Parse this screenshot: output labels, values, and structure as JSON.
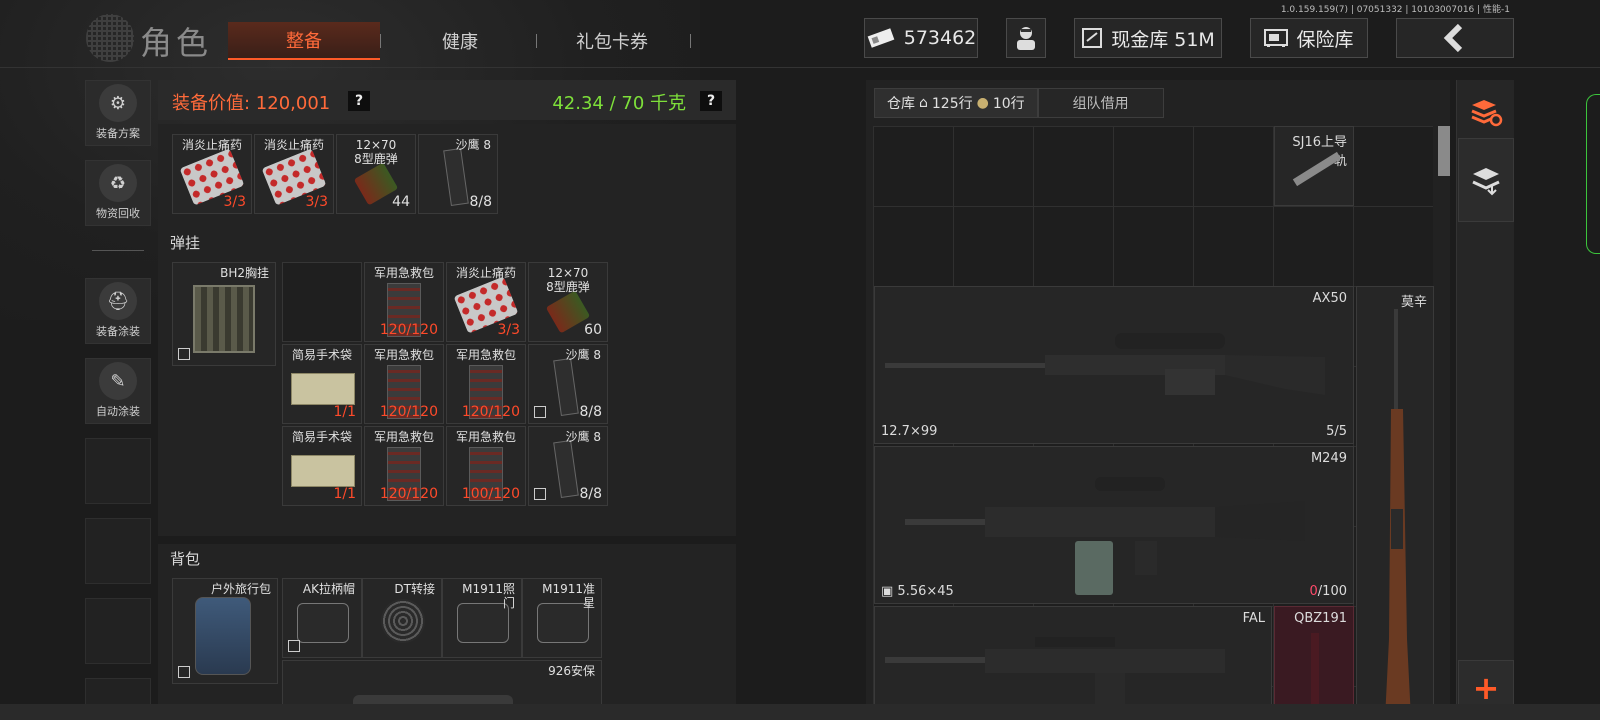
{
  "build_info": "1.0.159.159(7) | 07051332 | 10103007016 | 性能-1",
  "header": {
    "title": "角色",
    "tabs": [
      {
        "label": "整备",
        "active": true
      },
      {
        "label": "健康",
        "active": false
      },
      {
        "label": "礼包卡券",
        "active": false
      }
    ],
    "currency": "573462",
    "cash_vault": "现金库 51M",
    "safe_box": "保险库"
  },
  "sidebar": {
    "buttons": [
      {
        "label": "装备方案",
        "icon": "loadout-icon"
      },
      {
        "label": "物资回收",
        "icon": "recycle-icon"
      },
      {
        "label": "装备涂装",
        "icon": "helmet-paint-icon"
      },
      {
        "label": "自动涂装",
        "icon": "auto-paint-icon"
      }
    ]
  },
  "loadout": {
    "value_label": "装备价值: 120,001",
    "weight_label": "42.34 / 70 千克",
    "help": "?",
    "pockets": [
      {
        "name": "消炎止痛药",
        "qty": "3/3",
        "qty_color": "red",
        "art": "pills"
      },
      {
        "name": "消炎止痛药",
        "qty": "3/3",
        "qty_color": "red",
        "art": "pills"
      },
      {
        "name": "12×70\n8型鹿弹",
        "qty": "44",
        "qty_color": "white",
        "art": "shell"
      },
      {
        "name": "沙鹰 8",
        "qty": "8/8",
        "qty_color": "white",
        "art": "mag"
      }
    ],
    "rig_label": "弹挂",
    "rig": {
      "name": "BH2胸挂"
    },
    "rig_slots": [
      [
        null,
        {
          "name": "军用急救包",
          "qty": "120/120",
          "art": "medkit"
        },
        {
          "name": "消炎止痛药",
          "qty": "3/3",
          "art": "pills"
        },
        {
          "name": "12×70\n8型鹿弹",
          "qty": "60",
          "qty_color": "white",
          "art": "shell"
        }
      ],
      [
        {
          "name": "简易手术袋",
          "qty": "1/1",
          "art": "pouch"
        },
        {
          "name": "军用急救包",
          "qty": "120/120",
          "art": "medkit"
        },
        {
          "name": "军用急救包",
          "qty": "120/120",
          "art": "medkit"
        },
        {
          "name": "沙鹰 8",
          "qty": "8/8",
          "qty_color": "white",
          "art": "mag"
        }
      ],
      [
        {
          "name": "简易手术袋",
          "qty": "1/1",
          "art": "pouch"
        },
        {
          "name": "军用急救包",
          "qty": "120/120",
          "art": "medkit"
        },
        {
          "name": "军用急救包",
          "qty": "100/120",
          "art": "medkit"
        },
        {
          "name": "沙鹰 8",
          "qty": "8/8",
          "qty_color": "white",
          "art": "mag"
        }
      ]
    ],
    "backpack_label": "背包",
    "backpack": {
      "name": "户外旅行包"
    },
    "backpack_slots": [
      {
        "name": "AK拉柄帽",
        "art": "gearpart"
      },
      {
        "name": "DT转接",
        "art": "coil"
      },
      {
        "name": "M1911照\n门",
        "art": "gearpart"
      },
      {
        "name": "M1911准\n星",
        "art": "gearpart"
      }
    ],
    "backpack_extra": "926安保"
  },
  "warehouse": {
    "tab_label": "仓库",
    "rows_home": "125行",
    "rows_bag": "10行",
    "team_tab": "组队借用",
    "items": [
      {
        "name": "SJ16上导\n轨"
      },
      {
        "name": "AX50",
        "ammo": "12.7×99",
        "count": "5/5"
      },
      {
        "name": "M249",
        "ammo": "5.56×45",
        "count_zero": "0",
        "count_rest": "/100"
      },
      {
        "name": "莫辛"
      },
      {
        "name": "FAL"
      },
      {
        "name": "QBZ191"
      }
    ]
  },
  "colors": {
    "accent": "#ff6a3a",
    "weight": "#7ee03a",
    "qty_red": "#ff4a2a"
  }
}
